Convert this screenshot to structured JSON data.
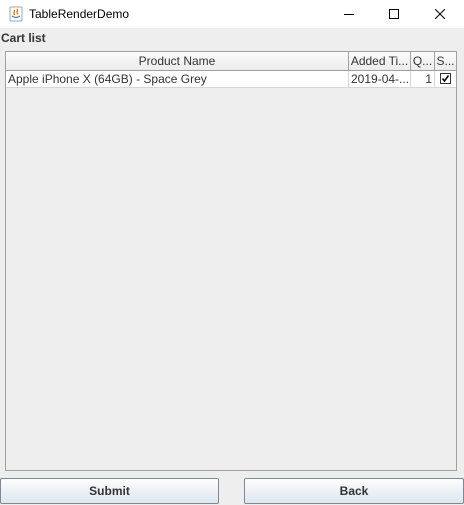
{
  "window": {
    "title": "TableRenderDemo",
    "minimize_icon": "minimize-icon",
    "maximize_icon": "maximize-icon",
    "close_icon": "close-icon"
  },
  "cart": {
    "label": "Cart list",
    "columns": [
      "Product Name",
      "Added Ti...",
      "Q...",
      "S..."
    ],
    "rows": [
      {
        "product": "Apple iPhone X (64GB) - Space Grey",
        "added": "2019-04-...",
        "qty": "1",
        "selected": true
      }
    ]
  },
  "buttons": {
    "submit": "Submit",
    "back": "Back"
  }
}
